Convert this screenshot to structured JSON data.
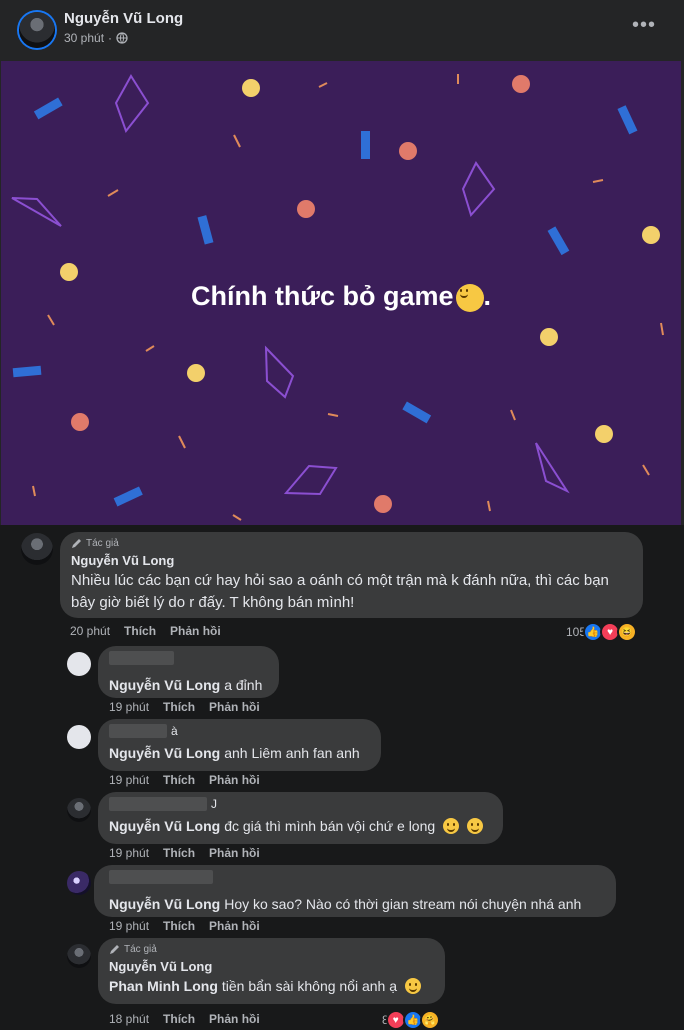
{
  "post": {
    "author": "Nguyễn Vũ Long",
    "time": "30 phút",
    "separator": "·",
    "privacy_icon": "globe-icon",
    "more_icon": "more-dots-icon",
    "more_label": "•••",
    "banner_text": "Chính thức bỏ game",
    "banner_end": ".",
    "banner_bg": "#3b1e59"
  },
  "comments": [
    {
      "badge": "Tác giả",
      "name": "Nguyễn Vũ Long",
      "text": "Nhiều lúc các bạn cứ hay hỏi sao a oánh có một trận mà k đánh nữa, thì các bạn bây giờ biết lý do r đấy. T không bán mình!",
      "time": "20 phút",
      "like": "Thích",
      "reply": "Phản hồi",
      "reactions_count": "105",
      "reaction_icons": [
        "like-icon",
        "love-icon",
        "haha-icon"
      ]
    }
  ],
  "replies": [
    {
      "tag": "Nguyễn Vũ Long",
      "text": "a đỉnh",
      "time": "19 phút",
      "like": "Thích",
      "reply": "Phản hồi"
    },
    {
      "tag": "Nguyễn Vũ Long",
      "text": "anh Liêm anh fan anh",
      "name_suffix": "à",
      "time": "19 phút",
      "like": "Thích",
      "reply": "Phản hồi"
    },
    {
      "tag": "Nguyễn Vũ Long",
      "text": "đc giá thì mình bán vội chứ e long",
      "name_suffix": "J",
      "time": "19 phút",
      "like": "Thích",
      "reply": "Phản hồi"
    },
    {
      "tag": "Nguyễn Vũ Long",
      "text": "Hoy ko sao? Nào có thời gian stream nói chuyện nhá anh",
      "time": "19 phút",
      "like": "Thích",
      "reply": "Phản hồi"
    },
    {
      "badge": "Tác giả",
      "name": "Nguyễn Vũ Long",
      "tag": "Phan Minh Long",
      "text": "tiền bẩn sài không nổi anh ạ",
      "time": "18 phút",
      "like": "Thích",
      "reply": "Phản hồi",
      "reactions_count": "8",
      "reaction_icons": [
        "love-icon",
        "like-icon",
        "care-icon"
      ]
    }
  ],
  "colors": {
    "like": "#1877f2",
    "love": "#f33e58",
    "haha": "#f7b125"
  }
}
